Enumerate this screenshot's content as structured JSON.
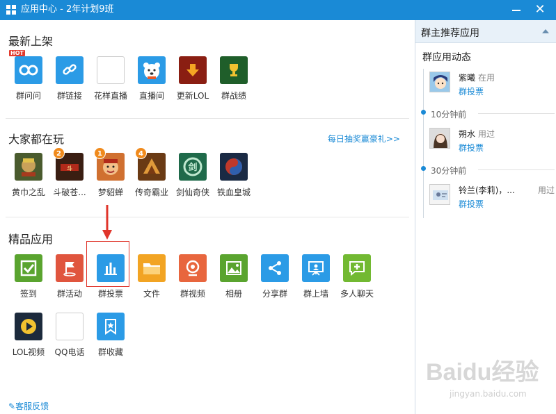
{
  "window": {
    "title": "应用中心 - 2年计划9班",
    "minimize_icon": "minimize-icon",
    "close_label": "✕"
  },
  "sections": {
    "newest": "最新上架",
    "popular": "大家都在玩",
    "featured": "精品应用",
    "promo_link": "每日抽奖赢豪礼>>"
  },
  "newest_apps": [
    {
      "label": "群问问",
      "hot": "HOT",
      "color": "#2b9be6"
    },
    {
      "label": "群链接",
      "color": "#2b9be6"
    },
    {
      "label": "花样直播",
      "color": "#ffffff"
    },
    {
      "label": "直播间",
      "color": "#2b9be6"
    },
    {
      "label": "更新LOL",
      "color": "#8a1e12"
    },
    {
      "label": "群战绩",
      "color": "#1f5e2a"
    }
  ],
  "popular_games": [
    {
      "label": "黄巾之乱",
      "badge": "",
      "color": "#4a5b2e"
    },
    {
      "label": "斗破苍...",
      "badge": "2",
      "color": "#3a1e12"
    },
    {
      "label": "梦貂蝉",
      "badge": "1",
      "color": "#d07030"
    },
    {
      "label": "传奇霸业",
      "badge": "4",
      "color": "#6a3a14"
    },
    {
      "label": "剑仙奇侠",
      "badge": "",
      "color": "#1f6a4a"
    },
    {
      "label": "铁血皇城",
      "badge": "",
      "color": "#1a2a44"
    }
  ],
  "featured_apps": [
    {
      "label": "签到",
      "color": "#5aa42f",
      "icon": "checkbox-icon"
    },
    {
      "label": "群活动",
      "color": "#e0553e",
      "icon": "flag-icon"
    },
    {
      "label": "群投票",
      "color": "#2b9be6",
      "icon": "bar-chart-icon"
    },
    {
      "label": "文件",
      "color": "#f2a423",
      "icon": "folder-icon"
    },
    {
      "label": "群视频",
      "color": "#e8663e",
      "icon": "camera-icon"
    },
    {
      "label": "相册",
      "color": "#5aa42f",
      "icon": "photo-icon"
    },
    {
      "label": "分享群",
      "color": "#2b9be6",
      "icon": "share-icon"
    },
    {
      "label": "群上墙",
      "color": "#2b9be6",
      "icon": "presentation-icon"
    },
    {
      "label": "多人聊天",
      "color": "#72b932",
      "icon": "chat-add-icon"
    },
    {
      "label": "LOL视频",
      "color": "#1c2a3c",
      "icon": "play-icon"
    },
    {
      "label": "QQ电话",
      "color": "#ffffff",
      "icon": "phone-icon"
    },
    {
      "label": "群收藏",
      "color": "#2b9be6",
      "icon": "bookmark-star-icon"
    }
  ],
  "feedback": "客服反馈",
  "right_panel": {
    "title": "群主推荐应用",
    "subtitle": "群应用动态",
    "feed": [
      {
        "name": "紫曦",
        "status": "在用",
        "action": "群投票"
      },
      {
        "time": "10分钟前",
        "name": "朔水",
        "status": "用过",
        "action": "群投票"
      },
      {
        "time": "30分钟前",
        "name": "铃兰(李莉)，...",
        "status": "用过",
        "action": "群投票"
      }
    ]
  },
  "watermark": {
    "text": "Baidu经验",
    "url": "jingyan.baidu.com"
  }
}
